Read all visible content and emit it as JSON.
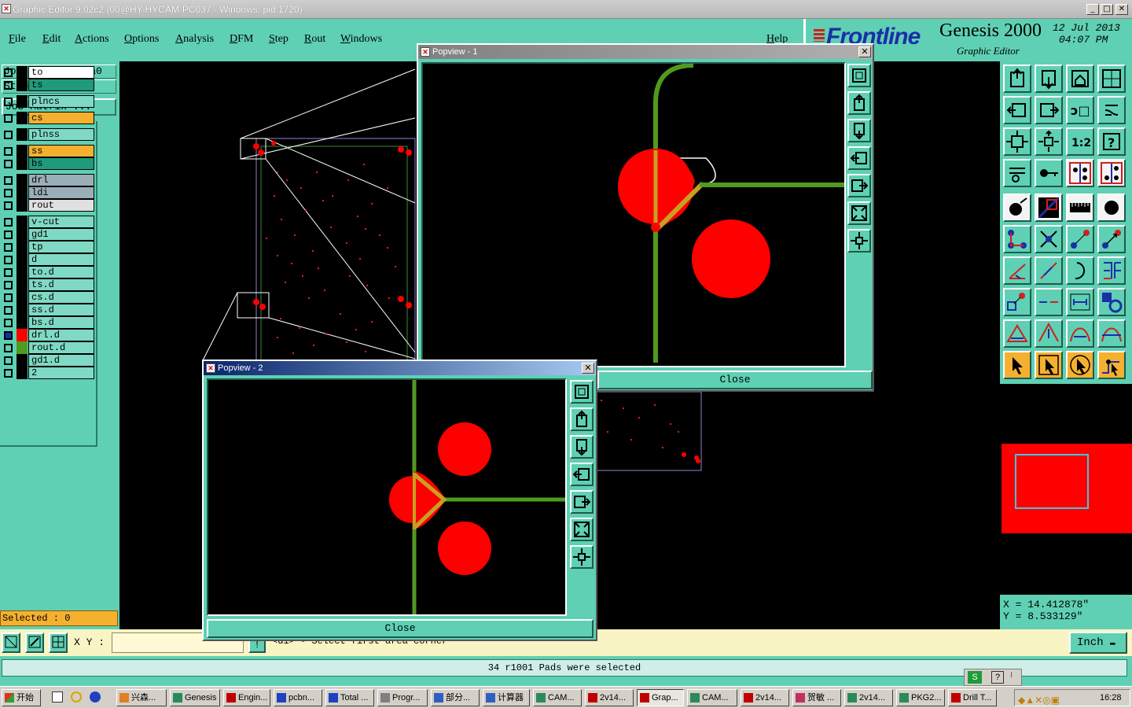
{
  "window": {
    "title": "Graphic Editor 9.02c2 (00@HY-HYCAM-PC037 - Windows, pid:1720)",
    "minimize_glyph": "_",
    "maximize_glyph": "□",
    "close_glyph": "✕"
  },
  "menu": {
    "file": "File",
    "edit": "Edit",
    "actions": "Actions",
    "options": "Options",
    "analysis": "Analysis",
    "dfm": "DFM",
    "step": "Step",
    "rout": "Rout",
    "windows": "Windows",
    "help": "Help"
  },
  "brand": {
    "logo": "Frontline",
    "product": "Genesis 2000",
    "subtitle": "Graphic Editor",
    "date": "12 Jul 2013",
    "time": "04:07 PM"
  },
  "left_panel": {
    "job_label": "Job : 2v144zqna0",
    "step_label": "Step: cam",
    "job_matrix_button": "Job Matrix ...",
    "selected_label": "Selected : 0",
    "layers": [
      {
        "name": "to",
        "color": "#ffffff"
      },
      {
        "name": "ts",
        "color": "#1f9b7a"
      },
      {
        "name": "plncs",
        "color": "#7fd9c4"
      },
      {
        "name": "cs",
        "color": "#f5b030"
      },
      {
        "name": "plnss",
        "color": "#7fd9c4"
      },
      {
        "name": "ss",
        "color": "#f5b030"
      },
      {
        "name": "bs",
        "color": "#1f9b7a"
      },
      {
        "name": "drl",
        "color": "#9aaeb8"
      },
      {
        "name": "ldi",
        "color": "#9aaeb8"
      },
      {
        "name": "rout",
        "color": "#e0e0e0"
      },
      {
        "name": "v-cut",
        "color": "#7fd9c4"
      },
      {
        "name": "gd1",
        "color": "#7fd9c4"
      },
      {
        "name": "tp",
        "color": "#7fd9c4"
      },
      {
        "name": "d",
        "color": "#7fd9c4"
      },
      {
        "name": "to.d",
        "color": "#7fd9c4"
      },
      {
        "name": "ts.d",
        "color": "#7fd9c4"
      },
      {
        "name": "cs.d",
        "color": "#7fd9c4"
      },
      {
        "name": "ss.d",
        "color": "#7fd9c4"
      },
      {
        "name": "bs.d",
        "color": "#7fd9c4"
      },
      {
        "name": "drl.d",
        "color": "#7fd9c4"
      },
      {
        "name": "rout.d",
        "color": "#7fd9c4"
      },
      {
        "name": "gd1.d",
        "color": "#7fd9c4"
      },
      {
        "name": "2",
        "color": "#7fd9c4"
      }
    ]
  },
  "coords": {
    "x": "X = 14.412878\"",
    "y": "Y = 8.533129\""
  },
  "command": {
    "xy_label": "X Y :",
    "prompt": "<d1> - Select first area corner",
    "unit": "Inch"
  },
  "status": {
    "message": "34 r1001 Pads were selected"
  },
  "popup1": {
    "title": "Popview - 1",
    "close_label": "Close"
  },
  "popup2": {
    "title": "Popview - 2",
    "close_label": "Close"
  },
  "taskbar": {
    "start": "开始",
    "tasks": [
      "兴森...",
      "Genesis",
      "Engin...",
      "pcbn...",
      "Total ...",
      "Progr...",
      "部分...",
      "计算器",
      "CAM...",
      "2v14...",
      "Grap...",
      "CAM...",
      "2v14...",
      "贺敏 ...",
      "2v14...",
      "PKG2...",
      "Drill T..."
    ],
    "clock": "16:28"
  },
  "colors": {
    "panel": "#5fd0b3",
    "pad": "#ff0000",
    "trace": "#4f9a1f",
    "highlight": "#f5b030"
  }
}
